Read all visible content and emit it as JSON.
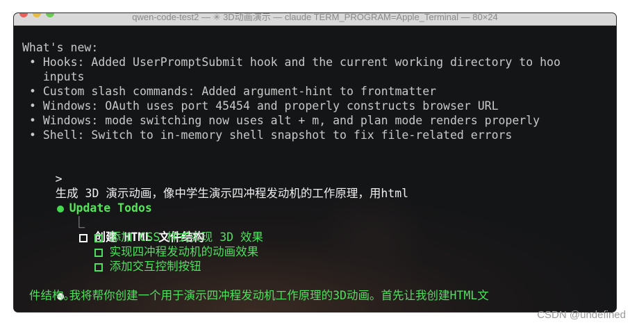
{
  "window": {
    "title": "qwen-code-test2 — ✳ 3D动画演示 — claude TERM_PROGRAM=Apple_Terminal — 80×24"
  },
  "terminal": {
    "whats_new_heading": "What's new:",
    "bullets": [
      "• Hooks: Added UserPromptSubmit hook and the current working directory to hoo",
      "  inputs",
      "• Custom slash commands: Added argument-hint to frontmatter",
      "• Windows: OAuth uses port 45454 and properly constructs browser URL",
      "• Windows: mode switching now uses alt + m, and plan mode renders properly",
      "• Shell: Switch to in-memory shell snapshot to fix file-related errors"
    ],
    "prompt_symbol": ">",
    "prompt_text": "生成 3D 演示动画，像中学生演示四冲程发动机的工作原理，用html",
    "update_todos_title": "Update Todos",
    "tree_connector": "⎿",
    "todos": [
      "创建 HTML 文件结构",
      "添加 CSS 样式实现 3D 效果",
      "实现四冲程发动机的动画效果",
      "添加交互控制按钮"
    ],
    "assistant_line1": "我将帮你创建一个用于演示四冲程发动机工作原理的3D动画。首先让我创建HTML文",
    "assistant_line2": "件结构。"
  },
  "watermark": "CSDN @undefined",
  "colors": {
    "background": "#141517",
    "text": "#cfcfcf",
    "green": "#4fe05f",
    "white": "#ffffff"
  }
}
